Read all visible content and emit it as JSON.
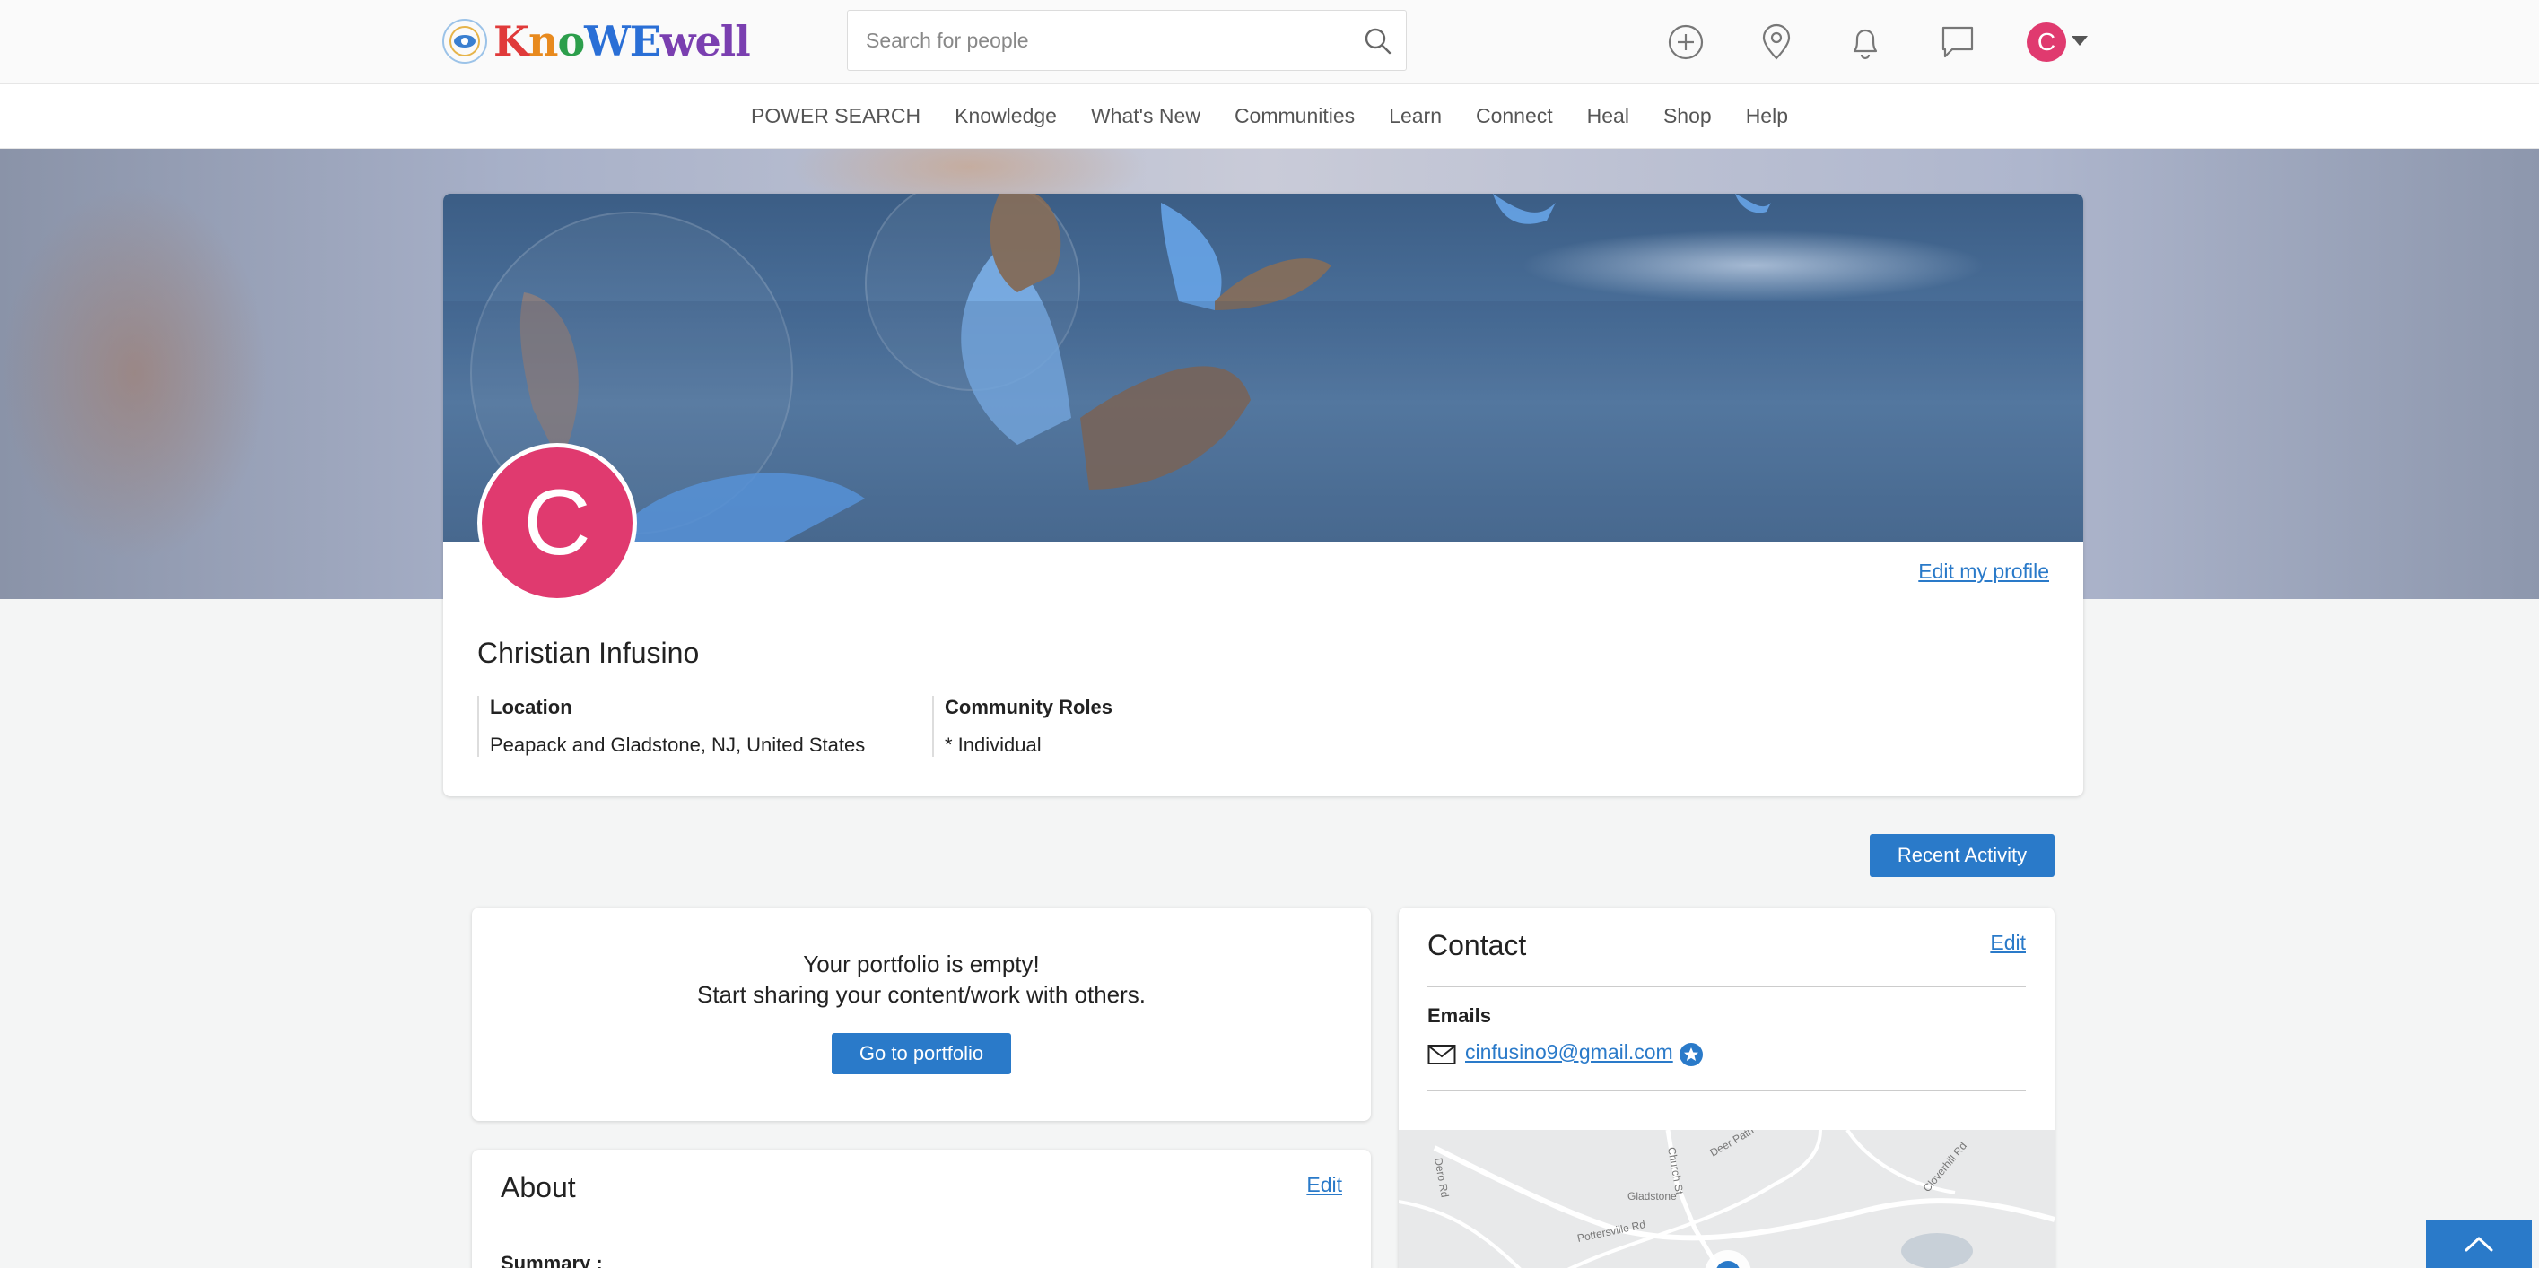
{
  "header": {
    "logo_text": "KnoWEwell",
    "search_placeholder": "Search for people",
    "avatar_initial": "C"
  },
  "nav": {
    "items": [
      "POWER SEARCH",
      "Knowledge",
      "What's New",
      "Communities",
      "Learn",
      "Connect",
      "Heal",
      "Shop",
      "Help"
    ]
  },
  "profile": {
    "avatar_initial": "C",
    "edit_label": "Edit my profile",
    "name": "Christian Infusino",
    "location_label": "Location",
    "location_value": "Peapack and Gladstone, NJ, United States",
    "roles_label": "Community Roles",
    "roles_value": "* Individual"
  },
  "recent_activity_label": "Recent Activity",
  "portfolio": {
    "line1": "Your portfolio is empty!",
    "line2": "Start sharing your content/work with others.",
    "button_label": "Go to portfolio"
  },
  "about": {
    "title": "About",
    "edit_label": "Edit",
    "summary_label": "Summary :"
  },
  "contact": {
    "title": "Contact",
    "edit_label": "Edit",
    "emails_label": "Emails",
    "email": "cinfusino9@gmail.com"
  },
  "map": {
    "labels": [
      "Dero Rd",
      "Church St",
      "Gladstone",
      "Pottersville Rd",
      "Deer Path",
      "Cloverhill Rd"
    ]
  },
  "colors": {
    "accent": "#2a7ac9",
    "avatar": "#e03a6f"
  },
  "icons": [
    "search-icon",
    "plus-circle-icon",
    "location-pin-icon",
    "bell-icon",
    "chat-icon",
    "chevron-down-icon",
    "envelope-icon",
    "star-badge-icon",
    "chevron-up-icon"
  ]
}
